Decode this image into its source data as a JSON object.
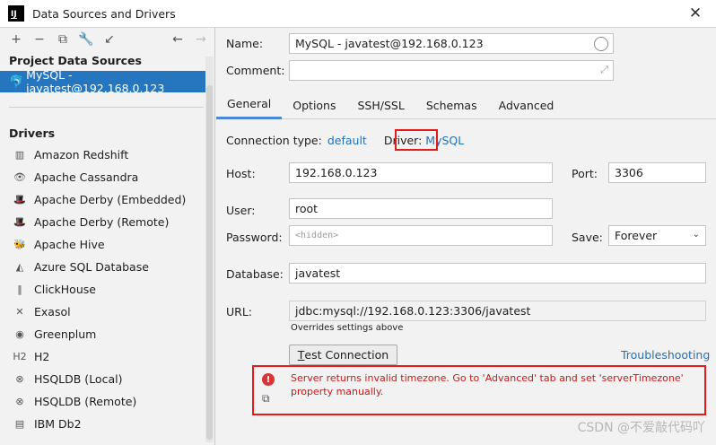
{
  "window": {
    "title": "Data Sources and Drivers",
    "app_icon": "IJ"
  },
  "left": {
    "project_header": "Project Data Sources",
    "selected_source": "MySQL - javatest@192.168.0.123",
    "drivers_header": "Drivers",
    "drivers": [
      {
        "label": "Amazon Redshift",
        "icon": "▥"
      },
      {
        "label": "Apache Cassandra",
        "icon": "👁"
      },
      {
        "label": "Apache Derby (Embedded)",
        "icon": "🎩"
      },
      {
        "label": "Apache Derby (Remote)",
        "icon": "🎩"
      },
      {
        "label": "Apache Hive",
        "icon": "🐝"
      },
      {
        "label": "Azure SQL Database",
        "icon": "◭"
      },
      {
        "label": "ClickHouse",
        "icon": "‖"
      },
      {
        "label": "Exasol",
        "icon": "✕"
      },
      {
        "label": "Greenplum",
        "icon": "◉"
      },
      {
        "label": "H2",
        "icon": "H2"
      },
      {
        "label": "HSQLDB (Local)",
        "icon": "⊗"
      },
      {
        "label": "HSQLDB (Remote)",
        "icon": "⊗"
      },
      {
        "label": "IBM Db2",
        "icon": "▤"
      }
    ]
  },
  "form": {
    "name_label": "Name:",
    "name_value": "MySQL - javatest@192.168.0.123",
    "comment_label": "Comment:",
    "tabs": [
      "General",
      "Options",
      "SSH/SSL",
      "Schemas",
      "Advanced"
    ],
    "conn_type_label": "Connection type:",
    "conn_type_value": "default",
    "driver_label": "Driver:",
    "driver_value": "MySQL",
    "host_label": "Host:",
    "host_value": "192.168.0.123",
    "port_label": "Port:",
    "port_value": "3306",
    "user_label": "User:",
    "user_value": "root",
    "password_label": "Password:",
    "password_placeholder": "<hidden>",
    "save_label": "Save:",
    "save_value": "Forever",
    "database_label": "Database:",
    "database_value": "javatest",
    "url_label": "URL:",
    "url_value": "jdbc:mysql://192.168.0.123:3306/javatest",
    "url_hint": "Overrides settings above",
    "test_button_mnemonic": "T",
    "test_button_rest": "est Connection",
    "troubleshooting": "Troubleshooting",
    "error_message": "Server returns invalid timezone. Go to 'Advanced' tab and set 'serverTimezone' property manually."
  },
  "watermark": "CSDN @不爱敲代码吖"
}
